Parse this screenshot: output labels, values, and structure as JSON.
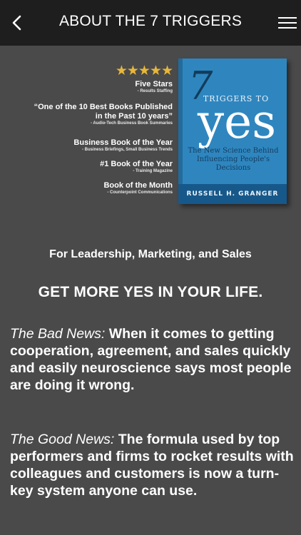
{
  "header": {
    "back_icon": "chevron-left-icon",
    "title": "ABOUT THE 7 TRIGGERS",
    "menu_icon": "hamburger-menu-icon"
  },
  "banner": {
    "stars": "★★★★★",
    "reviews": [
      {
        "main": "Five Stars",
        "source": "- Results Staffing"
      },
      {
        "main": "“One of the 10 Best Books Published",
        "main2": "in the Past 10 years”",
        "source": "- Audio-Tech Business Book Summaries"
      },
      {
        "main": "Business Book of the Year",
        "source": "- Business Briefings, Small Business Trends"
      },
      {
        "main": "#1 Book of the Year",
        "source": "- Training Magazine"
      },
      {
        "main": "Book of the Month",
        "source": "- Counterpoint Communications"
      }
    ],
    "book": {
      "seven": "7",
      "triggers": "TRIGGERS TO",
      "yes": "yes",
      "subtitle": "The New Science Behind Influencing People's Decisions",
      "author": "RUSSELL H. GRANGER"
    }
  },
  "content": {
    "subtitle": "For Leadership, Marketing, and Sales",
    "headline": "GET MORE YES IN YOUR LIFE.",
    "bad_label": "The Bad News:",
    "bad_text": " When it comes to getting cooperation, agreement, and sales quickly and easily neuroscience says most people are doing it wrong.",
    "good_label": "The Good News:",
    "good_text": " The formula used by top performers and firms to rocket results with colleagues and customers is now a turn-key system anyone can use."
  },
  "colors": {
    "topbar": "#1e1e1e",
    "background": "#4a4a4a",
    "stars": "#e8b73a",
    "book_cover": "#2f86bf"
  }
}
